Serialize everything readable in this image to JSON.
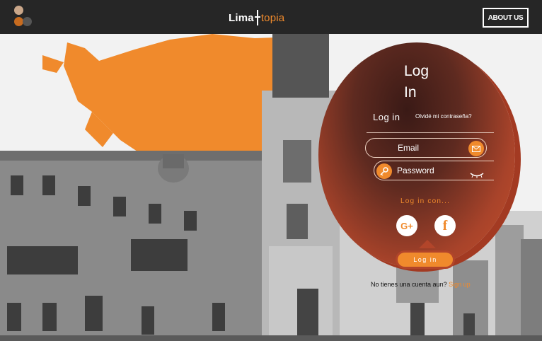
{
  "header": {
    "brand_left": "Lima",
    "brand_right": "topia",
    "about_label": "ABOUT US"
  },
  "login": {
    "title_line1": "Log",
    "title_line2": "In",
    "tab_label": "Log in",
    "forgot_label": "Olvidé mi contraseña?",
    "email_placeholder": "Email",
    "password_placeholder": "Password",
    "login_with_label": "Log in con...",
    "google_label": "G+",
    "facebook_label": "f",
    "submit_label": "Log in",
    "no_account_text": "No tienes una cuenta aun?",
    "signup_label": "Sign up"
  },
  "icons": {
    "logo": "logo-dots-icon",
    "email": "envelope-icon",
    "password": "key-icon",
    "toggle_password": "eye-closed-icon"
  },
  "colors": {
    "accent": "#f08a2c",
    "topbar": "#262626",
    "panel_dark": "#3a1a16",
    "panel_light": "#c9502c"
  }
}
